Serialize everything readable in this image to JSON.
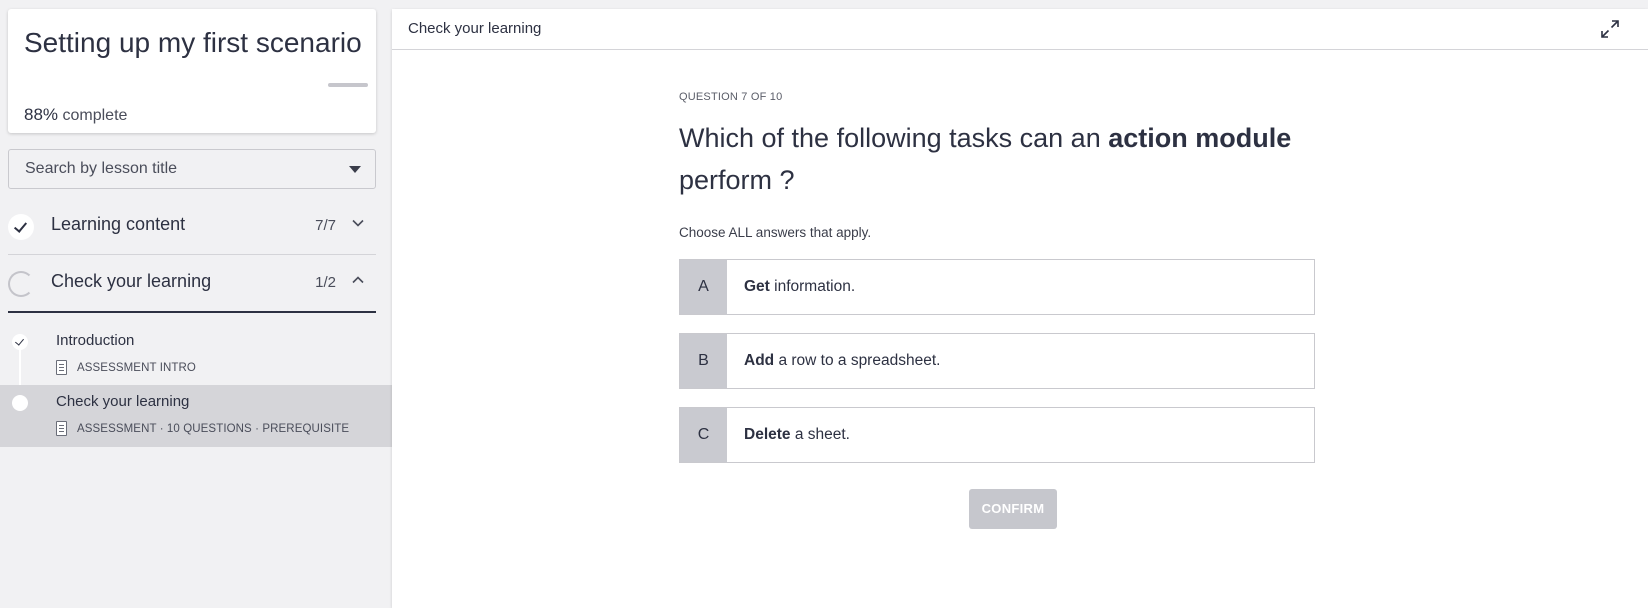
{
  "course": {
    "title": "Setting up my first scenario",
    "progress_percent": "88%",
    "progress_suffix": "complete",
    "progress_fraction": 0.88
  },
  "search": {
    "placeholder": "Search by lesson title"
  },
  "sections": [
    {
      "title": "Learning content",
      "count": "7/7",
      "status": "complete",
      "expanded": false
    },
    {
      "title": "Check your learning",
      "count": "1/2",
      "status": "in-progress",
      "expanded": true
    }
  ],
  "lessons": [
    {
      "title": "Introduction",
      "meta": "ASSESSMENT INTRO",
      "status": "done"
    },
    {
      "title": "Check your learning",
      "meta": "ASSESSMENT · 10 QUESTIONS · PREREQUISITE",
      "status": "current"
    }
  ],
  "main": {
    "header_title": "Check your learning",
    "question_counter": "QUESTION 7 OF 10",
    "question_prefix": "Which of the following tasks can an ",
    "question_bold": "action module",
    "question_suffix": " perform ?",
    "instruction": "Choose ALL answers that apply.",
    "options": [
      {
        "letter": "A",
        "bold": "Get",
        "rest": " information."
      },
      {
        "letter": "B",
        "bold": "Add",
        "rest": " a row to a spreadsheet."
      },
      {
        "letter": "C",
        "bold": "Delete",
        "rest": " a sheet."
      }
    ],
    "confirm_label": "CONFIRM"
  },
  "icons": {
    "expand": "expand-icon",
    "dropdown": "chevron-down-icon",
    "collapse": "chevron-up-icon",
    "check": "check-icon",
    "document": "document-icon"
  },
  "colors": {
    "text_dark": "#2d3142",
    "selected_row": "#d5d5d9",
    "option_letter_bg": "#c9cad0",
    "confirm_disabled": "#c6c7cd"
  }
}
